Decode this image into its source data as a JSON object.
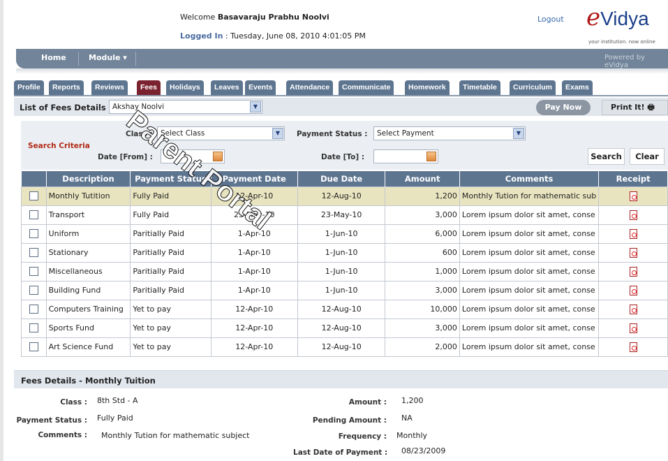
{
  "header": {
    "welcome_prefix": "Welcome",
    "user_name": "Basavaraju Prabhu Noolvi",
    "logged_in_label": "Logged In",
    "logged_in_value": ": Tuesday, June 08, 2010 4:01:05 PM",
    "logout": "Logout",
    "logo_first": "e",
    "logo_rest": "Vidya",
    "logo_tagline": "your institution. now online",
    "powered_by": "Powered by eVidya"
  },
  "nav": {
    "home": "Home",
    "module": "Module ▾"
  },
  "tabs": [
    "Profile",
    "Reports",
    "Reviews",
    "Fees",
    "Holidays",
    "Leaves",
    "Events",
    "Attendance",
    "Communicate",
    "Homework",
    "Timetable",
    "Curriculum",
    "Exams"
  ],
  "active_tab": "Fees",
  "list_bar": {
    "title": "List of Fees Details",
    "student": "Akshay Noolvi",
    "pay_now": "Pay Now",
    "print": "Print It!"
  },
  "search": {
    "criteria_label": "Search Criteria",
    "class_label": "Class :",
    "class_value": "Select Class",
    "payment_status_label": "Payment Status :",
    "payment_status_value": "Select Payment",
    "date_from_label": "Date [From] :",
    "date_to_label": "Date [To] :",
    "search_btn": "Search",
    "clear_btn": "Clear"
  },
  "table": {
    "headers": [
      "Description",
      "Payment Status",
      "Payment Date",
      "Due Date",
      "Amount",
      "Comments",
      "Receipt"
    ],
    "rows": [
      {
        "description": "Monthly Tutition",
        "status": "Fully Paid",
        "pay_date": "12-Apr-10",
        "due_date": "12-Aug-10",
        "amount": "1,200",
        "comments": "Monthly Tution for mathematic sub"
      },
      {
        "description": "Transport",
        "status": "Fully Paid",
        "pay_date": "23-May-10",
        "due_date": "23-May-10",
        "amount": "3,000",
        "comments": "Lorem ipsum dolor sit amet, conse"
      },
      {
        "description": "Uniform",
        "status": "Paritially Paid",
        "pay_date": "1-Apr-10",
        "due_date": "1-Jun-10",
        "amount": "6,000",
        "comments": "Lorem ipsum dolor sit amet, conse"
      },
      {
        "description": "Stationary",
        "status": "Paritially Paid",
        "pay_date": "1-Apr-10",
        "due_date": "1-Jun-10",
        "amount": "600",
        "comments": "Lorem ipsum dolor sit amet, conse"
      },
      {
        "description": "Miscellaneous",
        "status": "Paritially Paid",
        "pay_date": "1-Apr-10",
        "due_date": "1-Jun-10",
        "amount": "1,000",
        "comments": "Lorem ipsum dolor sit amet, conse"
      },
      {
        "description": "Building Fund",
        "status": "Paritially Paid",
        "pay_date": "1-Apr-10",
        "due_date": "1-Jun-10",
        "amount": "3,000",
        "comments": "Lorem ipsum dolor sit amet, conse"
      },
      {
        "description": "Computers Training",
        "status": "Yet to pay",
        "pay_date": "12-Apr-10",
        "due_date": "12-Aug-10",
        "amount": "10,000",
        "comments": "Lorem ipsum dolor sit amet, conse"
      },
      {
        "description": "Sports Fund",
        "status": "Yet to pay",
        "pay_date": "12-Apr-10",
        "due_date": "12-Aug-10",
        "amount": "3,000",
        "comments": "Lorem ipsum dolor sit amet, conse"
      },
      {
        "description": "Art Science Fund",
        "status": "Yet to pay",
        "pay_date": "12-Apr-10",
        "due_date": "12-Aug-10",
        "amount": "2,000",
        "comments": "Lorem ipsum dolor sit amet, conse"
      }
    ]
  },
  "details": {
    "title": "Fees Details - Monthly Tuition",
    "class_label": "Class :",
    "class_value": "8th Std - A",
    "payment_status_label": "Payment Status :",
    "payment_status_value": "Fully Paid",
    "comments_label": "Comments :",
    "comments_value": "Monthly Tution for mathematic subject",
    "amount_label": "Amount :",
    "amount_value": "1,200",
    "pending_label": "Pending Amount :",
    "pending_value": "NA",
    "frequency_label": "Frequency :",
    "frequency_value": "Monthly",
    "last_date_label": "Last Date of Payment :",
    "last_date_value": "08/23/2009"
  },
  "watermark": "Parent Portal",
  "colors": {
    "tab": "#5e7590",
    "active_tab": "#7a2230",
    "highlight_row": "#e8e4c0",
    "criteria": "#b22a18"
  }
}
